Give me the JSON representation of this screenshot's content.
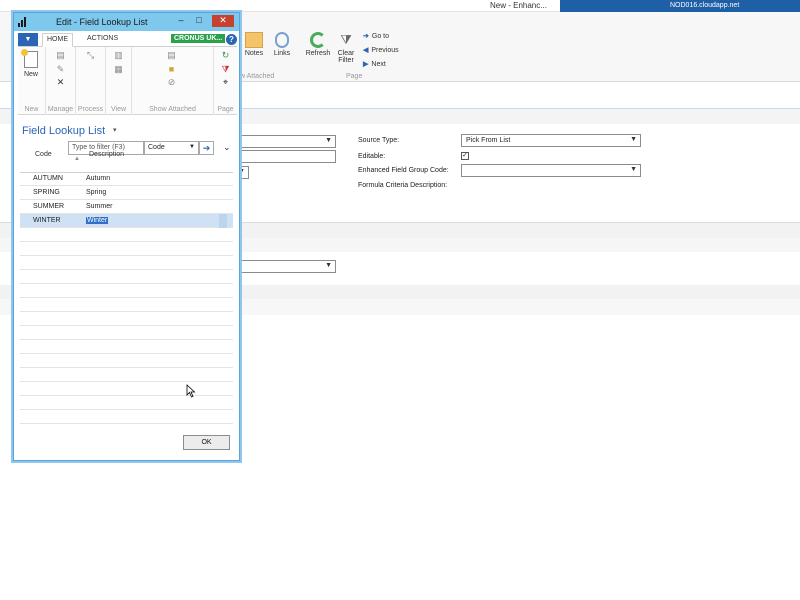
{
  "background_window": {
    "title": "New - Enhanc...",
    "host": "NOD016.cloudapp.net",
    "ribbon": {
      "notes_label": "Notes",
      "links_label": "Links",
      "show_attached_label": "w Attached",
      "refresh_label": "Refresh",
      "clear_filter_line1": "Clear",
      "clear_filter_line2": "Filter",
      "goto_label": "Go to",
      "previous_label": "Previous",
      "next_label": "Next",
      "page_group_label": "Page"
    },
    "fields": {
      "source_type_label": "Source Type:",
      "source_type_value": "Pick From List",
      "editable_label": "Editable:",
      "editable_checked": true,
      "enhanced_field_group_code_label": "Enhanced Field Group Code:",
      "enhanced_field_group_code_value": "",
      "formula_criteria_description_label": "Formula Criteria Description:"
    }
  },
  "dialog": {
    "title": "Edit - Field Lookup List",
    "window_buttons": {
      "minimize": "–",
      "maximize": "□",
      "close": "✕"
    },
    "tabs": {
      "home": "HOME",
      "actions": "ACTIONS"
    },
    "company_badge": "CRONUS UK...",
    "help": "?",
    "ribbon_groups": {
      "new": {
        "button_label": "New",
        "group_label": "New"
      },
      "manage": {
        "group_label": "Manage"
      },
      "process": {
        "group_label": "Process"
      },
      "view": {
        "group_label": "View"
      },
      "show_attached": {
        "group_label": "Show Attached"
      },
      "page": {
        "group_label": "Page"
      }
    },
    "list_title": "Field Lookup List",
    "filter": {
      "placeholder": "Type to filter (F3)",
      "field": "Code"
    },
    "columns": {
      "code": "Code",
      "description": "Description"
    },
    "rows": [
      {
        "code": "AUTUMN",
        "description": "Autumn"
      },
      {
        "code": "SPRING",
        "description": "Spring"
      },
      {
        "code": "SUMMER",
        "description": "Summer"
      },
      {
        "code": "WINTER",
        "description": "Winter"
      }
    ],
    "selected_row": "WINTER",
    "ok_label": "OK"
  }
}
